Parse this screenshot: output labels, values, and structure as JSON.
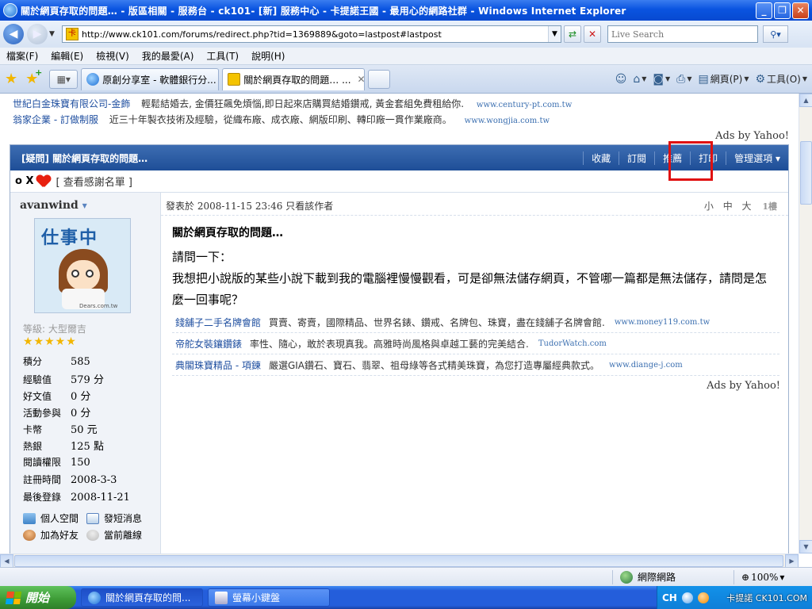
{
  "window": {
    "title": "關於網頁存取的問題… - 版區相關 - 服務台 - ck101- [新] 服務中心 - 卡提諾王國 - 最用心的網路社群 - Windows Internet Explorer",
    "minimize": "_",
    "maximize": "❐",
    "close": "✕"
  },
  "address": {
    "url": "http://www.ck101.com/forums/redirect.php?tid=1369889&goto=lastpost#lastpost",
    "search_placeholder": "Live Search"
  },
  "menu": [
    "檔案(F)",
    "編輯(E)",
    "檢視(V)",
    "我的最愛(A)",
    "工具(T)",
    "說明(H)"
  ],
  "tabs": [
    {
      "label": "原創分享室 - 軟體銀行分...",
      "active": false
    },
    {
      "label": "關於網頁存取的問題… ...",
      "active": true
    }
  ],
  "command_bar": {
    "page_label": "網頁(P)",
    "tools_label": "工具(O)"
  },
  "top_ads": [
    {
      "link": "世紀白金珠寶有限公司-金飾",
      "desc": "輕鬆結婚去, 金價狂飆免煩惱,即日起來店購買結婚鑽戒, 黃金套組免費租給你.",
      "url": "www.century-pt.com.tw"
    },
    {
      "link": "翁家企業 - 訂做制服",
      "desc": "近三十年製衣技術及經驗，從織布廠、成衣廠、網版印刷、轉印廠一貫作業廠商。",
      "url": "www.wongjia.com.tw"
    }
  ],
  "ads_by_yahoo": "Ads by Yahoo!",
  "post": {
    "header_title": "[疑問] 關於網頁存取的問題…",
    "actions": [
      "收藏",
      "訂閱",
      "推薦",
      "打印",
      "管理選項"
    ],
    "manage_arrow": "▾",
    "thanks_prefix": "o X",
    "thanks_link": "[ 查看感謝名單 ]",
    "author": {
      "name": "avanwind",
      "avatar_text": "仕事中",
      "avatar_site": "Dears.com.tw",
      "grade": "等級: 大型爾吉",
      "stars": "★★★★★",
      "stats": [
        {
          "key": "積分",
          "value": "585"
        },
        {
          "key": "經驗值",
          "value": "579 分"
        },
        {
          "key": "好文值",
          "value": "0 分"
        },
        {
          "key": "活動參與",
          "value": "0 分"
        },
        {
          "key": "卡幣",
          "value": "50 元"
        },
        {
          "key": "熱銀",
          "value": "125 點"
        },
        {
          "key": "閱讀權限",
          "value": "150"
        },
        {
          "key": "註冊時間",
          "value": "2008-3-3"
        },
        {
          "key": "最後登錄",
          "value": "2008-11-21"
        }
      ],
      "links": [
        "個人空間",
        "發短消息",
        "加為好友",
        "當前離線"
      ]
    },
    "meta_prefix": "發表於",
    "meta_date": "2008-11-15 23:46",
    "meta_only_author": "只看該作者",
    "font_sizes": "小 中 大",
    "floor": "1樓",
    "title": "關於網頁存取的問題…",
    "body_lines": [
      "請問一下：",
      "我想把小說版的某些小說下載到我的電腦裡慢慢觀看，可是卻無法儲存網頁，不管哪一篇都是無法儲存，請問是怎麼一回事呢？"
    ],
    "inline_ads": [
      {
        "link": "錢舖子二手名牌會館",
        "desc": "買賣、寄賣，國際精品、世界名錶、鑽戒、名牌包、珠寶，盡在錢舖子名牌會館.",
        "url": "www.money119.com.tw"
      },
      {
        "link": "帝舵女裝鑲鑽錶",
        "desc": "率性、隨心，敢於表現真我。高雅時尚風格與卓越工藝的完美結合.",
        "url": "TudorWatch.com"
      },
      {
        "link": "典閣珠寶精品 - 項鍊",
        "desc": "嚴選GIA鑽石、寶石、翡翠、祖母綠等各式精美珠寶，為您打造專屬經典款式。",
        "url": "www.diange-j.com"
      }
    ]
  },
  "status": {
    "zone": "網際網路",
    "zoom": "100%"
  },
  "taskbar": {
    "start": "開始",
    "buttons": [
      {
        "label": "關於網頁存取的問...",
        "active": true
      },
      {
        "label": "螢幕小鍵盤",
        "active": false
      }
    ],
    "tray_ch": "CH",
    "tray_brand": "卡提諾 CK101.COM"
  },
  "colors": {
    "post_header": "#1e4e97",
    "highlight_box": "#e01010",
    "link": "#1f4fa0"
  }
}
